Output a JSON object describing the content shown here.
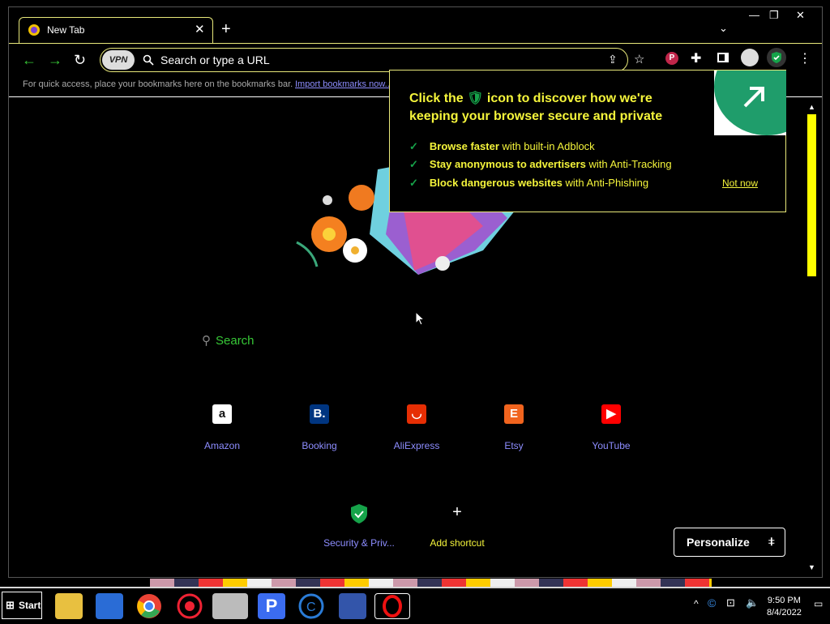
{
  "browser": {
    "tab_title": "New Tab",
    "omnibox_placeholder": "Search or type a URL",
    "vpn_label": "VPN",
    "bookmarks_bar": {
      "hint": "For quick access, place your bookmarks here on the bookmarks bar.",
      "import_link": "Import bookmarks now..."
    }
  },
  "popup": {
    "title_before": "Click the",
    "title_after": "icon to discover how we're keeping your browser secure and private",
    "features": [
      {
        "bold": "Browse faster",
        "rest": "with built-in Adblock"
      },
      {
        "bold": "Stay anonymous to advertisers",
        "rest": "with Anti-Tracking"
      },
      {
        "bold": "Block dangerous websites",
        "rest": "with Anti-Phishing"
      }
    ],
    "not_now": "Not now"
  },
  "newtab": {
    "search_label": "Search",
    "shortcuts": [
      {
        "label": "Amazon",
        "icon": "amazon-icon",
        "glyph": "a",
        "bg": "#ffffff",
        "fg": "#111111"
      },
      {
        "label": "Booking",
        "icon": "booking-icon",
        "glyph": "B.",
        "bg": "#003580",
        "fg": "#ffffff"
      },
      {
        "label": "AliExpress",
        "icon": "aliexpress-icon",
        "glyph": "◡",
        "bg": "#e62e04",
        "fg": "#ffffff"
      },
      {
        "label": "Etsy",
        "icon": "etsy-icon",
        "glyph": "E",
        "bg": "#f1641e",
        "fg": "#ffffff"
      },
      {
        "label": "YouTube",
        "icon": "youtube-icon",
        "glyph": "▶",
        "bg": "#ff0000",
        "fg": "#ffffff"
      }
    ],
    "security_shortcut": "Security & Priv...",
    "add_shortcut": "Add shortcut",
    "personalize": "Personalize"
  },
  "taskbar": {
    "start_label": "Start",
    "time": "9:50 PM",
    "date": "8/4/2022"
  },
  "colors": {
    "accent_yellow": "#f5f53b",
    "link_blue": "#8d8dff",
    "green": "#37c837",
    "shield_green": "#16a34a"
  }
}
